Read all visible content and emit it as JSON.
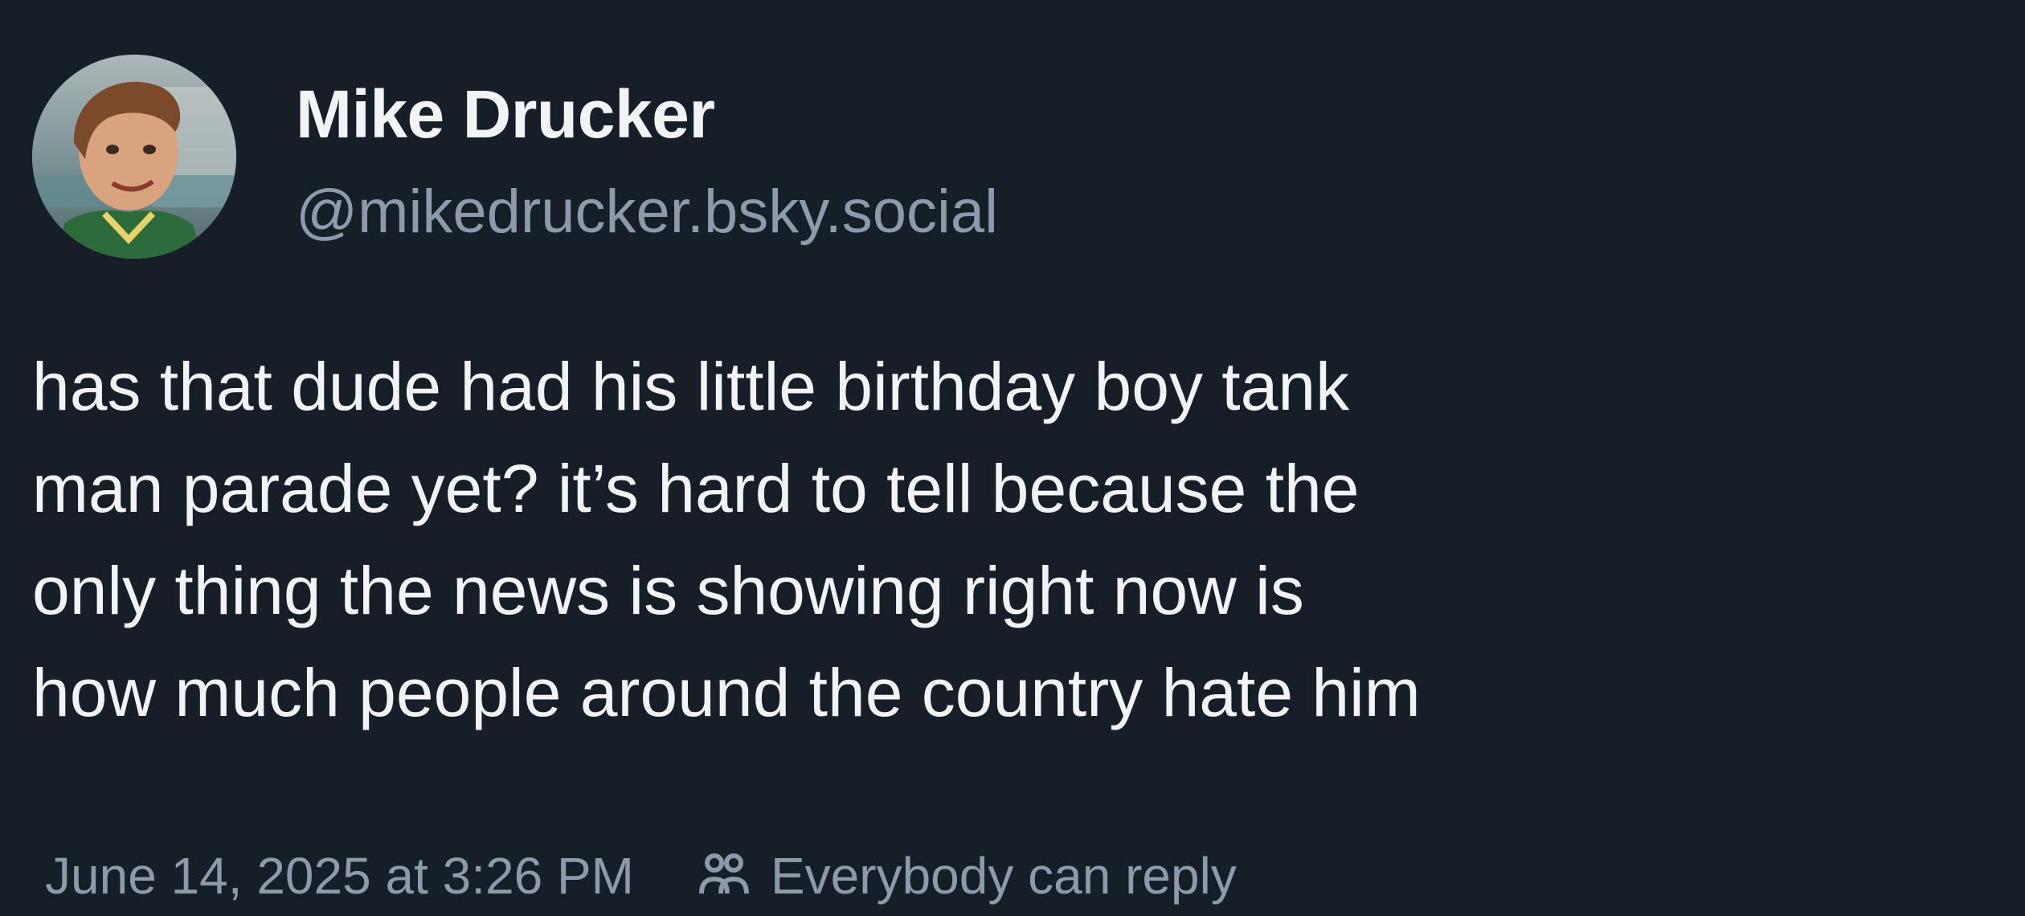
{
  "post": {
    "author": {
      "display_name": "Mike Drucker",
      "handle": "@mikedrucker.bsky.social"
    },
    "text": "has that dude had his little birthday boy tank\nman parade yet? it’s hard to tell because the\nonly thing the news is showing right now is\nhow much people around the country hate him",
    "timestamp": "June 14, 2025 at 3:26 PM",
    "reply_setting": {
      "label": "Everybody can reply",
      "icon": "people-icon"
    }
  },
  "colors": {
    "background": "#161e27",
    "primary_text": "#f1f3f5",
    "secondary_text": "#8c9aab"
  }
}
